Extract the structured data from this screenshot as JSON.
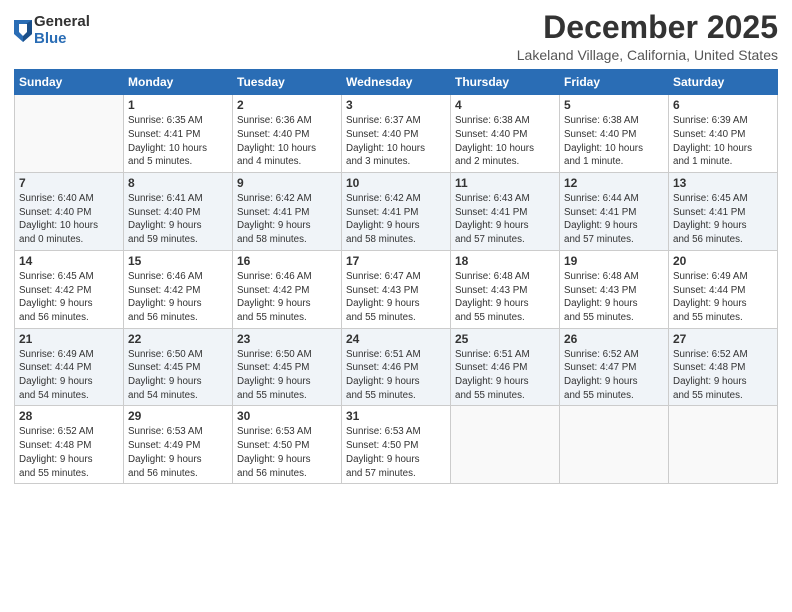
{
  "logo": {
    "general": "General",
    "blue": "Blue"
  },
  "header": {
    "month": "December 2025",
    "location": "Lakeland Village, California, United States"
  },
  "days_of_week": [
    "Sunday",
    "Monday",
    "Tuesday",
    "Wednesday",
    "Thursday",
    "Friday",
    "Saturday"
  ],
  "weeks": [
    [
      {
        "day": "",
        "info": ""
      },
      {
        "day": "1",
        "info": "Sunrise: 6:35 AM\nSunset: 4:41 PM\nDaylight: 10 hours\nand 5 minutes."
      },
      {
        "day": "2",
        "info": "Sunrise: 6:36 AM\nSunset: 4:40 PM\nDaylight: 10 hours\nand 4 minutes."
      },
      {
        "day": "3",
        "info": "Sunrise: 6:37 AM\nSunset: 4:40 PM\nDaylight: 10 hours\nand 3 minutes."
      },
      {
        "day": "4",
        "info": "Sunrise: 6:38 AM\nSunset: 4:40 PM\nDaylight: 10 hours\nand 2 minutes."
      },
      {
        "day": "5",
        "info": "Sunrise: 6:38 AM\nSunset: 4:40 PM\nDaylight: 10 hours\nand 1 minute."
      },
      {
        "day": "6",
        "info": "Sunrise: 6:39 AM\nSunset: 4:40 PM\nDaylight: 10 hours\nand 1 minute."
      }
    ],
    [
      {
        "day": "7",
        "info": "Sunrise: 6:40 AM\nSunset: 4:40 PM\nDaylight: 10 hours\nand 0 minutes."
      },
      {
        "day": "8",
        "info": "Sunrise: 6:41 AM\nSunset: 4:40 PM\nDaylight: 9 hours\nand 59 minutes."
      },
      {
        "day": "9",
        "info": "Sunrise: 6:42 AM\nSunset: 4:41 PM\nDaylight: 9 hours\nand 58 minutes."
      },
      {
        "day": "10",
        "info": "Sunrise: 6:42 AM\nSunset: 4:41 PM\nDaylight: 9 hours\nand 58 minutes."
      },
      {
        "day": "11",
        "info": "Sunrise: 6:43 AM\nSunset: 4:41 PM\nDaylight: 9 hours\nand 57 minutes."
      },
      {
        "day": "12",
        "info": "Sunrise: 6:44 AM\nSunset: 4:41 PM\nDaylight: 9 hours\nand 57 minutes."
      },
      {
        "day": "13",
        "info": "Sunrise: 6:45 AM\nSunset: 4:41 PM\nDaylight: 9 hours\nand 56 minutes."
      }
    ],
    [
      {
        "day": "14",
        "info": "Sunrise: 6:45 AM\nSunset: 4:42 PM\nDaylight: 9 hours\nand 56 minutes."
      },
      {
        "day": "15",
        "info": "Sunrise: 6:46 AM\nSunset: 4:42 PM\nDaylight: 9 hours\nand 56 minutes."
      },
      {
        "day": "16",
        "info": "Sunrise: 6:46 AM\nSunset: 4:42 PM\nDaylight: 9 hours\nand 55 minutes."
      },
      {
        "day": "17",
        "info": "Sunrise: 6:47 AM\nSunset: 4:43 PM\nDaylight: 9 hours\nand 55 minutes."
      },
      {
        "day": "18",
        "info": "Sunrise: 6:48 AM\nSunset: 4:43 PM\nDaylight: 9 hours\nand 55 minutes."
      },
      {
        "day": "19",
        "info": "Sunrise: 6:48 AM\nSunset: 4:43 PM\nDaylight: 9 hours\nand 55 minutes."
      },
      {
        "day": "20",
        "info": "Sunrise: 6:49 AM\nSunset: 4:44 PM\nDaylight: 9 hours\nand 55 minutes."
      }
    ],
    [
      {
        "day": "21",
        "info": "Sunrise: 6:49 AM\nSunset: 4:44 PM\nDaylight: 9 hours\nand 54 minutes."
      },
      {
        "day": "22",
        "info": "Sunrise: 6:50 AM\nSunset: 4:45 PM\nDaylight: 9 hours\nand 54 minutes."
      },
      {
        "day": "23",
        "info": "Sunrise: 6:50 AM\nSunset: 4:45 PM\nDaylight: 9 hours\nand 55 minutes."
      },
      {
        "day": "24",
        "info": "Sunrise: 6:51 AM\nSunset: 4:46 PM\nDaylight: 9 hours\nand 55 minutes."
      },
      {
        "day": "25",
        "info": "Sunrise: 6:51 AM\nSunset: 4:46 PM\nDaylight: 9 hours\nand 55 minutes."
      },
      {
        "day": "26",
        "info": "Sunrise: 6:52 AM\nSunset: 4:47 PM\nDaylight: 9 hours\nand 55 minutes."
      },
      {
        "day": "27",
        "info": "Sunrise: 6:52 AM\nSunset: 4:48 PM\nDaylight: 9 hours\nand 55 minutes."
      }
    ],
    [
      {
        "day": "28",
        "info": "Sunrise: 6:52 AM\nSunset: 4:48 PM\nDaylight: 9 hours\nand 55 minutes."
      },
      {
        "day": "29",
        "info": "Sunrise: 6:53 AM\nSunset: 4:49 PM\nDaylight: 9 hours\nand 56 minutes."
      },
      {
        "day": "30",
        "info": "Sunrise: 6:53 AM\nSunset: 4:50 PM\nDaylight: 9 hours\nand 56 minutes."
      },
      {
        "day": "31",
        "info": "Sunrise: 6:53 AM\nSunset: 4:50 PM\nDaylight: 9 hours\nand 57 minutes."
      },
      {
        "day": "",
        "info": ""
      },
      {
        "day": "",
        "info": ""
      },
      {
        "day": "",
        "info": ""
      }
    ]
  ]
}
